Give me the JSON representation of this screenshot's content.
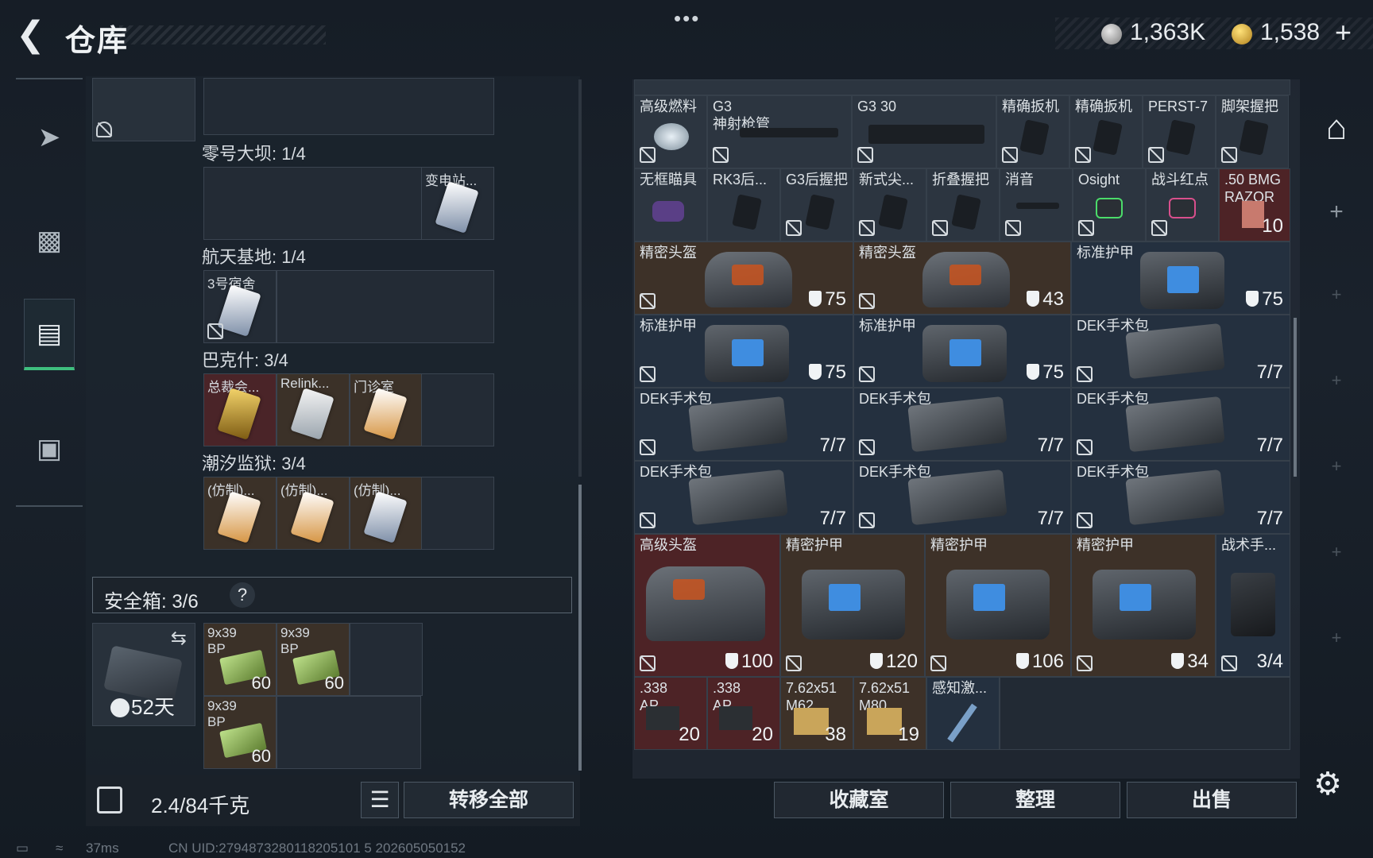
{
  "header": {
    "back_icon": "back-arrow-icon",
    "title": "仓库",
    "menu_dots": "•••",
    "silver_amount": "1,363K",
    "gold_amount": "1,538",
    "plus": "+"
  },
  "left_nav": {
    "items": [
      "weapon-icon",
      "backpack-icon",
      "container-icon",
      "toolbox-icon"
    ],
    "active": "container-icon"
  },
  "stash_groups": [
    {
      "label": "零号大坝: 1/4",
      "items": [
        "变电站..."
      ]
    },
    {
      "label": "航天基地: 1/4",
      "items": [
        "3号宿舍"
      ]
    },
    {
      "label": "巴克什: 3/4",
      "items": [
        "总裁会...",
        "Relink...",
        "门诊室"
      ]
    },
    {
      "label": "潮汐监狱: 3/4",
      "items": [
        "(仿制)...",
        "(仿制)...",
        "(仿制)..."
      ]
    }
  ],
  "safe_box": {
    "label": "安全箱:  3/6",
    "help": "?",
    "days": "52天",
    "items": [
      {
        "name": "9x39\nBP",
        "qty": "60"
      },
      {
        "name": "9x39\nBP",
        "qty": "60"
      },
      {
        "name": "9x39\nBP",
        "qty": "60"
      }
    ]
  },
  "footer_left": {
    "weight": "2.4/84千克",
    "transfer_all": "转移全部"
  },
  "inventory": {
    "row1": [
      {
        "name": "高级燃料"
      },
      {
        "name": "G3\n神射枪管"
      },
      {
        "name": "G3 30"
      },
      {
        "name": "精确扳机"
      },
      {
        "name": "精确扳机"
      },
      {
        "name": "PERST-7"
      },
      {
        "name": "脚架握把"
      }
    ],
    "row2": [
      {
        "name": "无框瞄具"
      },
      {
        "name": "RK3后..."
      },
      {
        "name": "G3后握把"
      },
      {
        "name": "新式尖..."
      },
      {
        "name": "折叠握把"
      },
      {
        "name": "消音"
      },
      {
        "name": "Osight"
      },
      {
        "name": "战斗红点"
      },
      {
        "name": ".50 BMG\nRAZOR",
        "qty": "10"
      }
    ],
    "row3": [
      {
        "name": "精密头盔",
        "value": "75"
      },
      {
        "name": "精密头盔",
        "value": "43"
      },
      {
        "name": "标准护甲",
        "value": "75"
      }
    ],
    "row4": [
      {
        "name": "标准护甲",
        "value": "75"
      },
      {
        "name": "标准护甲",
        "value": "75"
      },
      {
        "name": "DEK手术包",
        "value": "7/7"
      }
    ],
    "row5": [
      {
        "name": "DEK手术包",
        "value": "7/7"
      },
      {
        "name": "DEK手术包",
        "value": "7/7"
      },
      {
        "name": "DEK手术包",
        "value": "7/7"
      }
    ],
    "row6": [
      {
        "name": "DEK手术包",
        "value": "7/7"
      },
      {
        "name": "DEK手术包",
        "value": "7/7"
      },
      {
        "name": "DEK手术包",
        "value": "7/7"
      }
    ],
    "row7": [
      {
        "name": "高级头盔",
        "value": "100"
      },
      {
        "name": "精密护甲",
        "value": "120"
      },
      {
        "name": "精密护甲",
        "value": "106"
      },
      {
        "name": "精密护甲",
        "value": "34"
      },
      {
        "name": "战术手...",
        "value": "3/4"
      }
    ],
    "row8": [
      {
        "name": ".338\nAP",
        "qty": "20"
      },
      {
        "name": ".338\nAP",
        "qty": "20"
      },
      {
        "name": "7.62x51\nM62",
        "qty": "38"
      },
      {
        "name": "7.62x51\nM80",
        "qty": "19"
      },
      {
        "name": "感知激..."
      }
    ]
  },
  "bottom_buttons": {
    "collection": "收藏室",
    "organize": "整理",
    "sell": "出售"
  },
  "status": {
    "ping": "37ms",
    "uid": "CN UID:2794873280118205101 5 202605050152"
  }
}
